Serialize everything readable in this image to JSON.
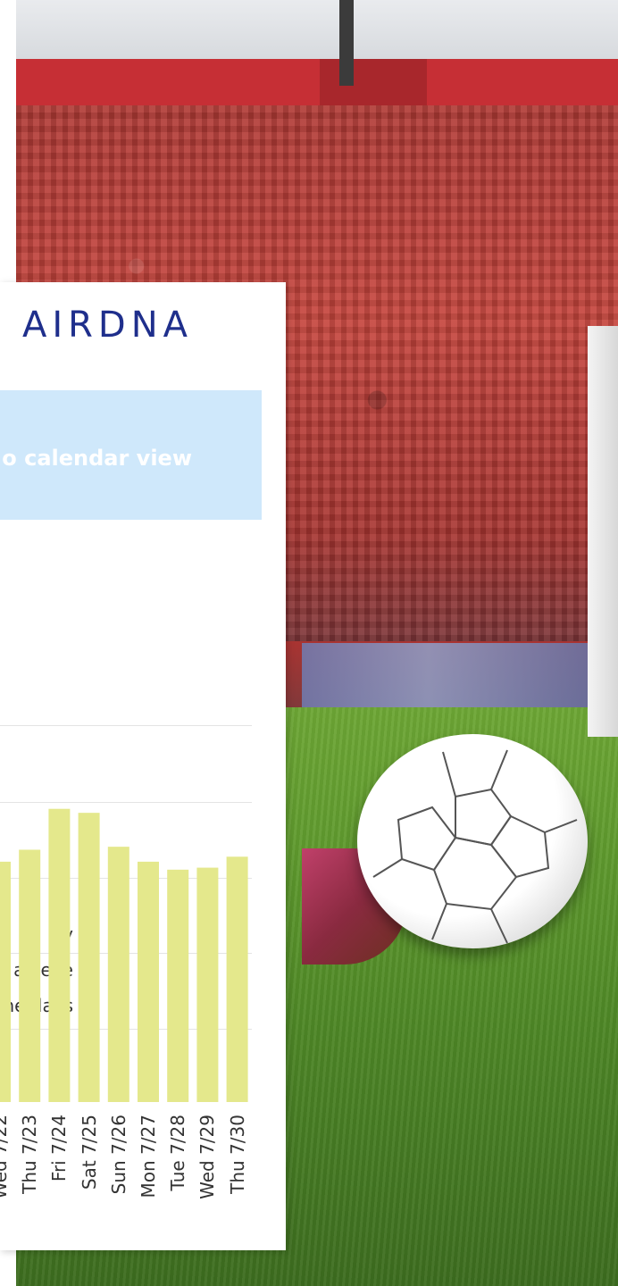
{
  "brand": {
    "logo_text": "AIRDNA"
  },
  "cta": {
    "text": "o calendar view"
  },
  "legend": [
    {
      "label": "ay"
    },
    {
      "label": "ay eve"
    },
    {
      "label": "ne days"
    }
  ],
  "colors": {
    "bar": "#e4e88c",
    "brand": "#1f2f8c",
    "cta_bg": "#cfe8fb"
  },
  "chart_data": {
    "type": "bar",
    "categories": [
      "Wed 7/22",
      "Thu 7/23",
      "Fri 7/24",
      "Sat 7/25",
      "Sun 7/26",
      "Mon 7/27",
      "Tue 7/28",
      "Wed 7/29",
      "Thu 7/30"
    ],
    "values": [
      2.41,
      2.53,
      2.94,
      2.9,
      2.56,
      2.41,
      2.33,
      2.35,
      2.46
    ],
    "ylim": [
      0,
      3
    ],
    "grid": true
  }
}
